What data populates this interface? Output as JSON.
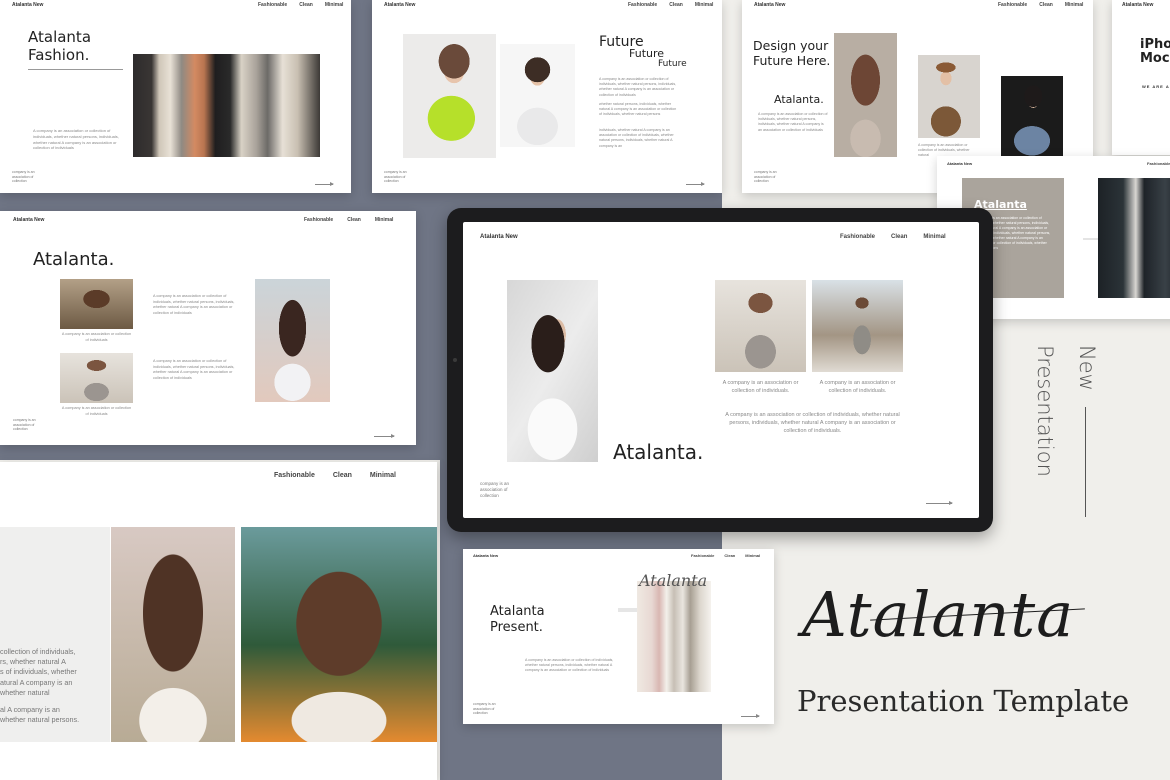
{
  "brand": "Atalanta New",
  "nav": [
    "Fashionable",
    "Clean",
    "Minimal"
  ],
  "small_caption": "company is an association of collection",
  "slide1": {
    "title_line1": "Atalanta",
    "title_line2": "Fashion.",
    "para": "A company is an association or collection of individuals, whether natural persons, individuals, whether natural A company is an association or collection of individuals"
  },
  "slide2": {
    "title_line1": "Future",
    "title_line2": "Future",
    "title_line3": "Future",
    "para1": "A company is an association or collection of individuals, whether natural persons, individuals, whether natural A company is an association or collection of individuals",
    "para2": "whether natural persons, individuals, whether natural A company is an association or collection of individuals, whether natural persons",
    "para3": "individuals, whether natural A company is an association or collection of individuals, whether natural persons, individuals, whether natural A company is an"
  },
  "slide3": {
    "title_line1": "Design your",
    "title_line2": "Future Here.",
    "subtitle": "Atalanta.",
    "para": "A company is an association or collection of individuals, whether natural persons, individuals, whether natural A company is an association or collection of individuals",
    "para2": "A company is an association or collection of individuals, whether natural"
  },
  "slide4": {
    "title_line1": "iPhone",
    "title_line2": "Mock",
    "caption": "WE ARE A"
  },
  "slide5": {
    "title": "Atalanta.",
    "cap1": "A company is an association or collection of individuals",
    "cap2": "A company is an association or collection of individuals",
    "para1": "A company is an association or collection of individuals, whether natural persons, individuals, whether natural A company is an association or collection of individuals",
    "para2": "A company is an association or collection of individuals, whether natural persons, individuals, whether natural A company is an association or collection of individuals"
  },
  "slide6": {
    "title": "Atalanta",
    "para": "A company is an association or collection of individuals, whether natural persons, individuals, whether natural A company is an association or collection of individuals, whether natural persons, individuals, whether natural A company is an association or collection of individuals, whether natural persons"
  },
  "tablet": {
    "title": "Atalanta.",
    "cap1": "A company is an association or collection of individuals.",
    "cap2": "A company is an association or collection of individuals.",
    "para": "A company is an association or collection of individuals, whether natural persons, individuals, whether natural A company is an association or collection of individuals."
  },
  "slide7": {
    "para_lines": [
      "collection of individuals,",
      "rs, whether natural A",
      "s of individuals, whether",
      "atural A company is an",
      "whether natural",
      "al A company is an",
      "whether natural persons."
    ]
  },
  "slide8": {
    "title_line1": "Atalanta",
    "title_line2": "Present.",
    "para": "A company is an association or collection of individuals, whether natural persons, individuals, whether natural A company is an association or collection of individuals",
    "overlay_script": "Atalanta"
  },
  "branding": {
    "vertical_top": "New",
    "vertical_bottom": "Presentation",
    "signature": "Atalanta",
    "tagline": "Presentation Template"
  }
}
